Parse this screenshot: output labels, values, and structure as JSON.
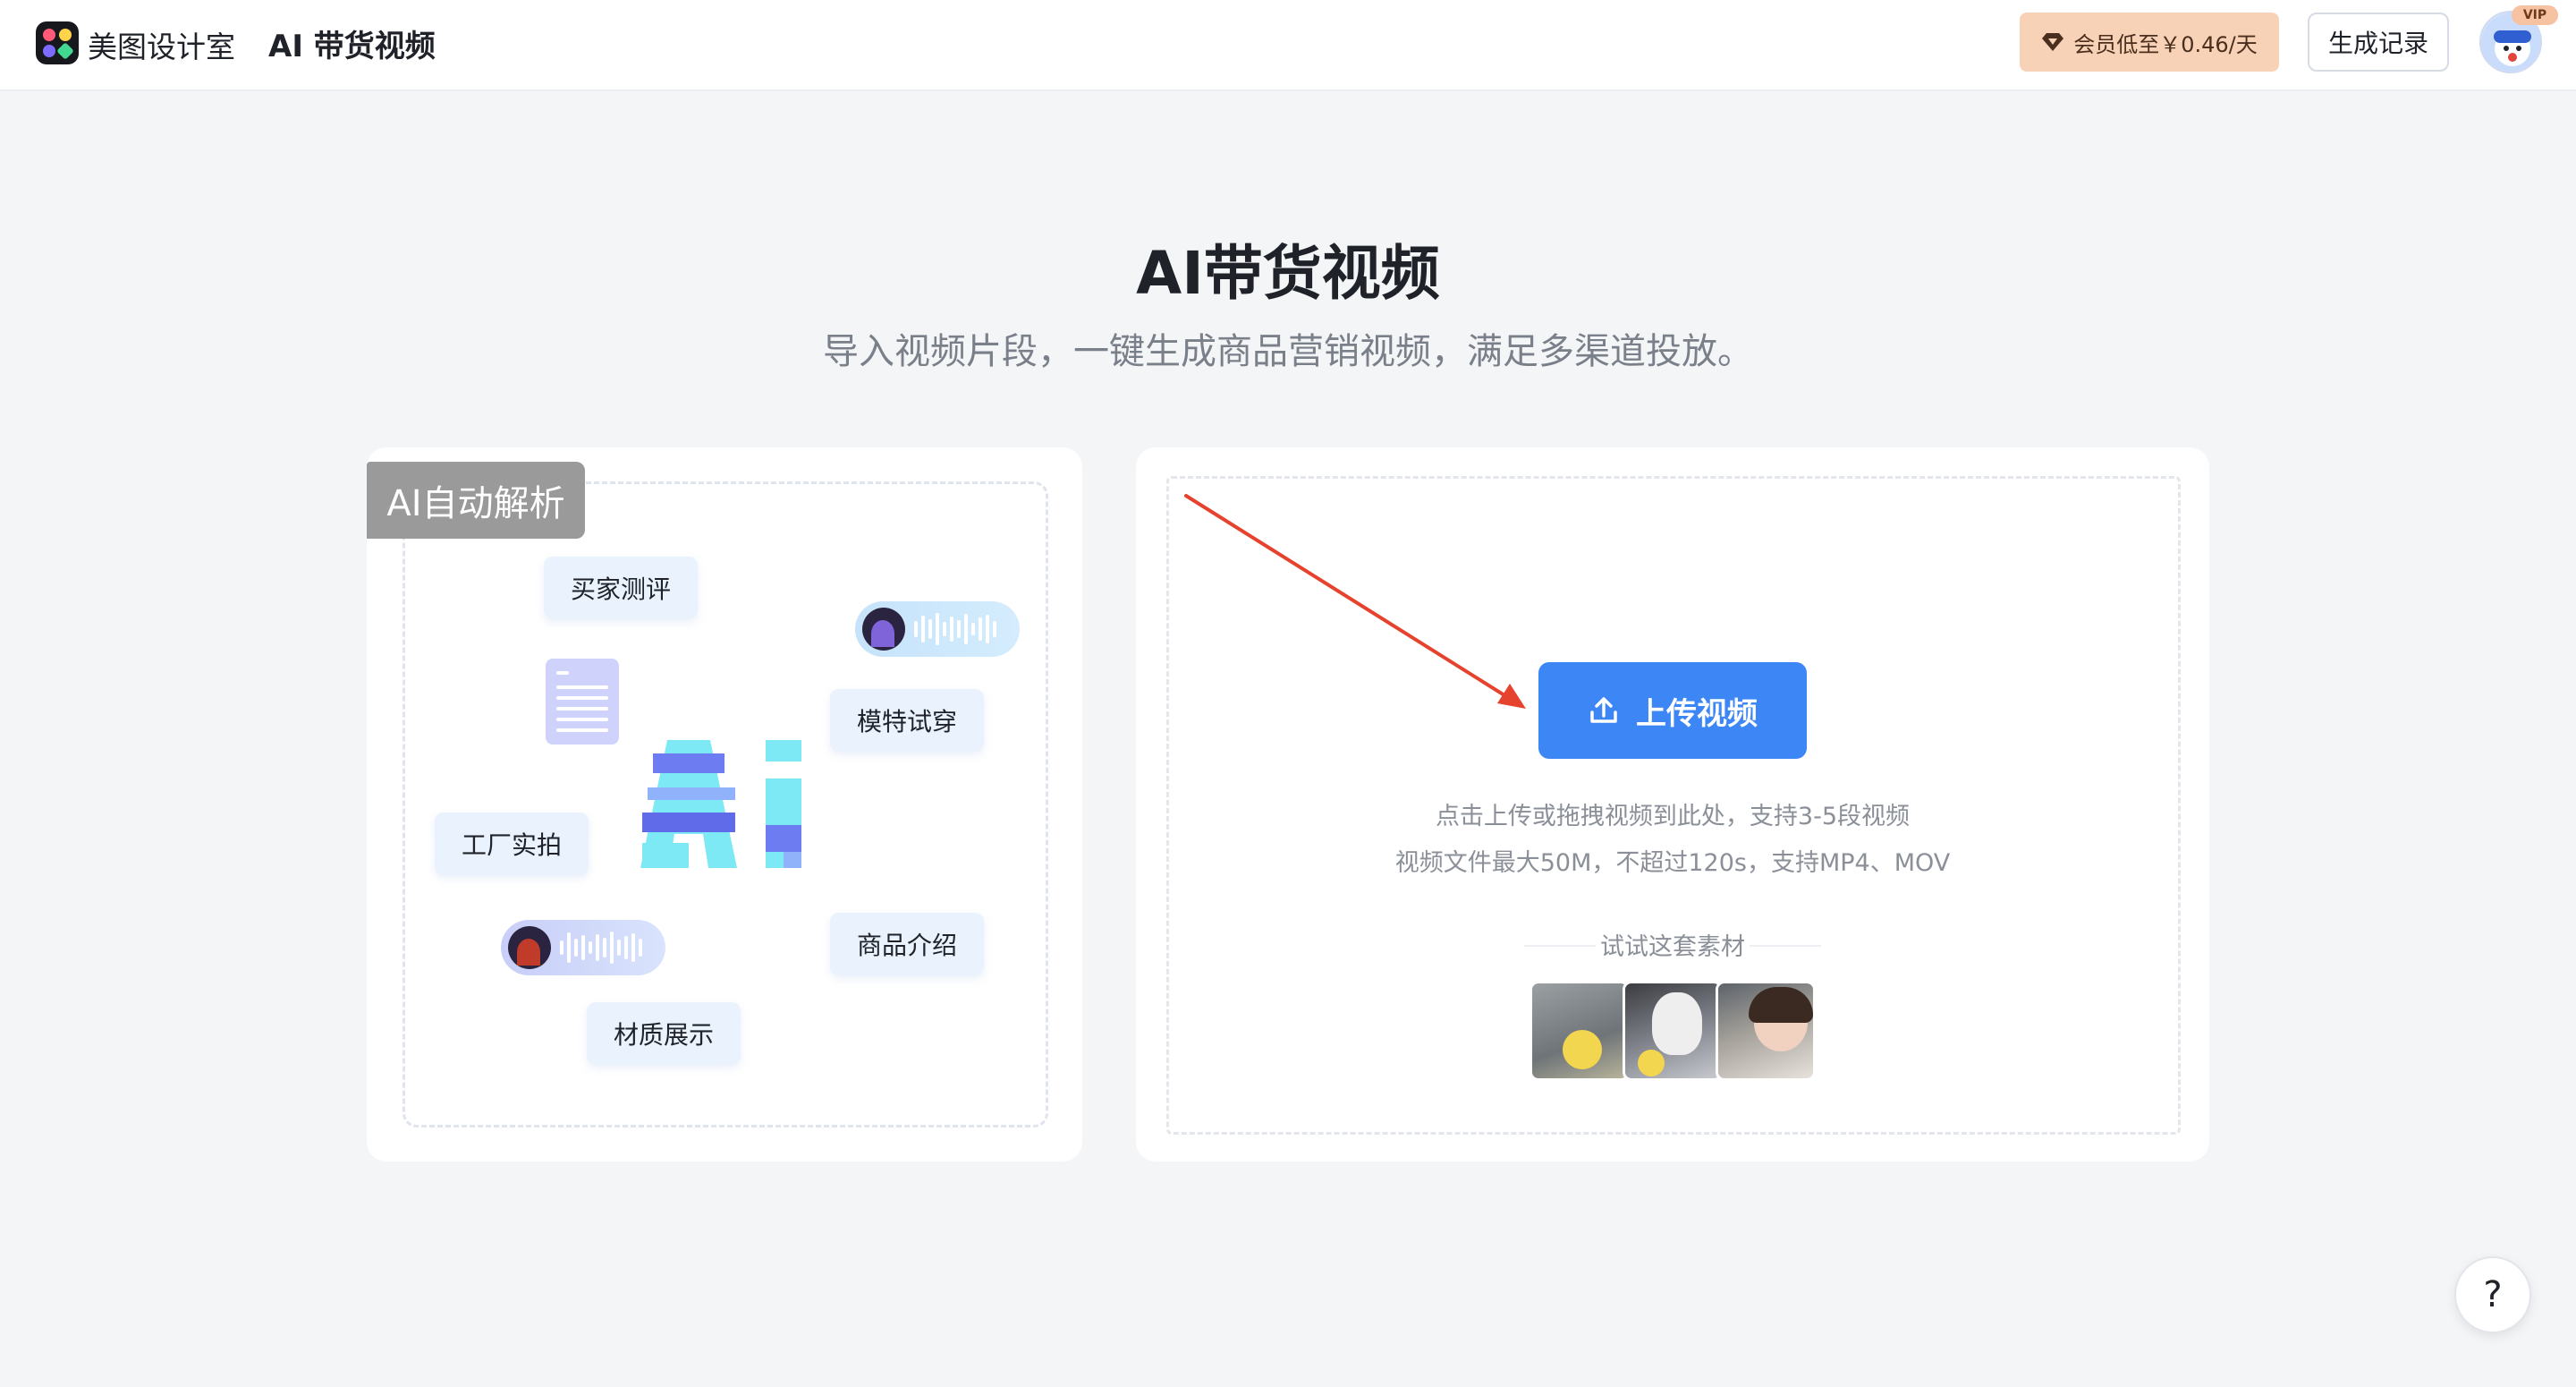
{
  "header": {
    "brand": "美图设计室",
    "page_name": "AI 带货视频",
    "vip_promo": "会员低至￥0.46/天",
    "history_button": "生成记录",
    "vip_badge": "VIP"
  },
  "hero": {
    "title": "AI带货视频",
    "subtitle": "导入视频片段，一键生成商品营销视频，满足多渠道投放。"
  },
  "left_card": {
    "tag": "AI自动解析",
    "chips": [
      "买家测评",
      "模特试穿",
      "工厂实拍",
      "商品介绍",
      "材质展示"
    ]
  },
  "upload": {
    "button_label": "上传视频",
    "hint_line1": "点击上传或拖拽视频到此处，支持3-5段视频",
    "hint_line2": "视频文件最大50M，不超过120s，支持MP4、MOV",
    "try_label": "试试这套素材"
  },
  "help": {
    "label": "?"
  },
  "colors": {
    "primary": "#3d86f6",
    "vip_bg": "#f8d2b7",
    "annotation_arrow": "#e5432d"
  },
  "icons": [
    "logo-icon",
    "diamond-icon",
    "upload-icon",
    "help-icon"
  ]
}
